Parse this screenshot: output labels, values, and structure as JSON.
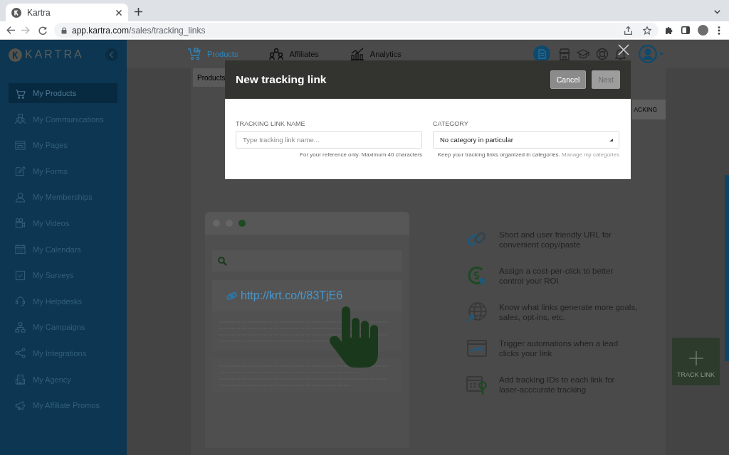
{
  "browser": {
    "tab_title": "Kartra",
    "url_host": "app.kartra.com",
    "url_path": "/sales/tracking_links"
  },
  "sidebar": {
    "logo": "KARTRA",
    "items": [
      {
        "label": "My Products",
        "selected": true
      },
      {
        "label": "My Communications",
        "selected": false
      },
      {
        "label": "My Pages",
        "selected": false
      },
      {
        "label": "My Forms",
        "selected": false
      },
      {
        "label": "My Memberships",
        "selected": false
      },
      {
        "label": "My Videos",
        "selected": false
      },
      {
        "label": "My Calendars",
        "selected": false
      },
      {
        "label": "My Surveys",
        "selected": false
      },
      {
        "label": "My Helpdesks",
        "selected": false
      },
      {
        "label": "My Campaigns",
        "selected": false
      },
      {
        "label": "My Integrations",
        "selected": false
      },
      {
        "label": "My Agency",
        "selected": false
      },
      {
        "label": "My Affiliate Promos",
        "selected": false
      }
    ]
  },
  "top_nav": {
    "items": [
      {
        "label": "Products",
        "selected": true
      },
      {
        "label": "Affiliates",
        "selected": false
      },
      {
        "label": "Analytics",
        "selected": false
      }
    ]
  },
  "sub_nav": {
    "tab": "Products",
    "right_tab": "ACKING"
  },
  "illustration": {
    "url": "http://krt.co/t/83TjE6"
  },
  "features": [
    {
      "lines": [
        "Short and user friendly URL for",
        "convenient copy/paste"
      ]
    },
    {
      "lines": [
        "Assign a cost-per-click to better",
        "control your ROI"
      ]
    },
    {
      "lines": [
        "Know what links generate more goals,",
        "sales, opt-ins, etc."
      ]
    },
    {
      "lines": [
        "Trigger automations when a lead",
        "clicks your link"
      ]
    },
    {
      "lines": [
        "Add tracking IDs to each link for",
        "laser-acccurate tracking"
      ]
    }
  ],
  "track_button": {
    "label": "TRACK LINK"
  },
  "modal": {
    "title": "New tracking link",
    "buttons": [
      {
        "label": "Cancel",
        "disabled": false
      },
      {
        "label": "Next",
        "disabled": true
      }
    ],
    "fields": [
      {
        "kind": "text",
        "label": "TRACKING LINK NAME",
        "placeholder": "Type tracking link name...",
        "hint": "For your reference only. Maximum 40 characters"
      },
      {
        "kind": "select",
        "label": "CATEGORY",
        "value": "No category in particular",
        "hint": "Keep your tracking links organized in categories.",
        "hint_link": "Manage my categories"
      }
    ]
  }
}
